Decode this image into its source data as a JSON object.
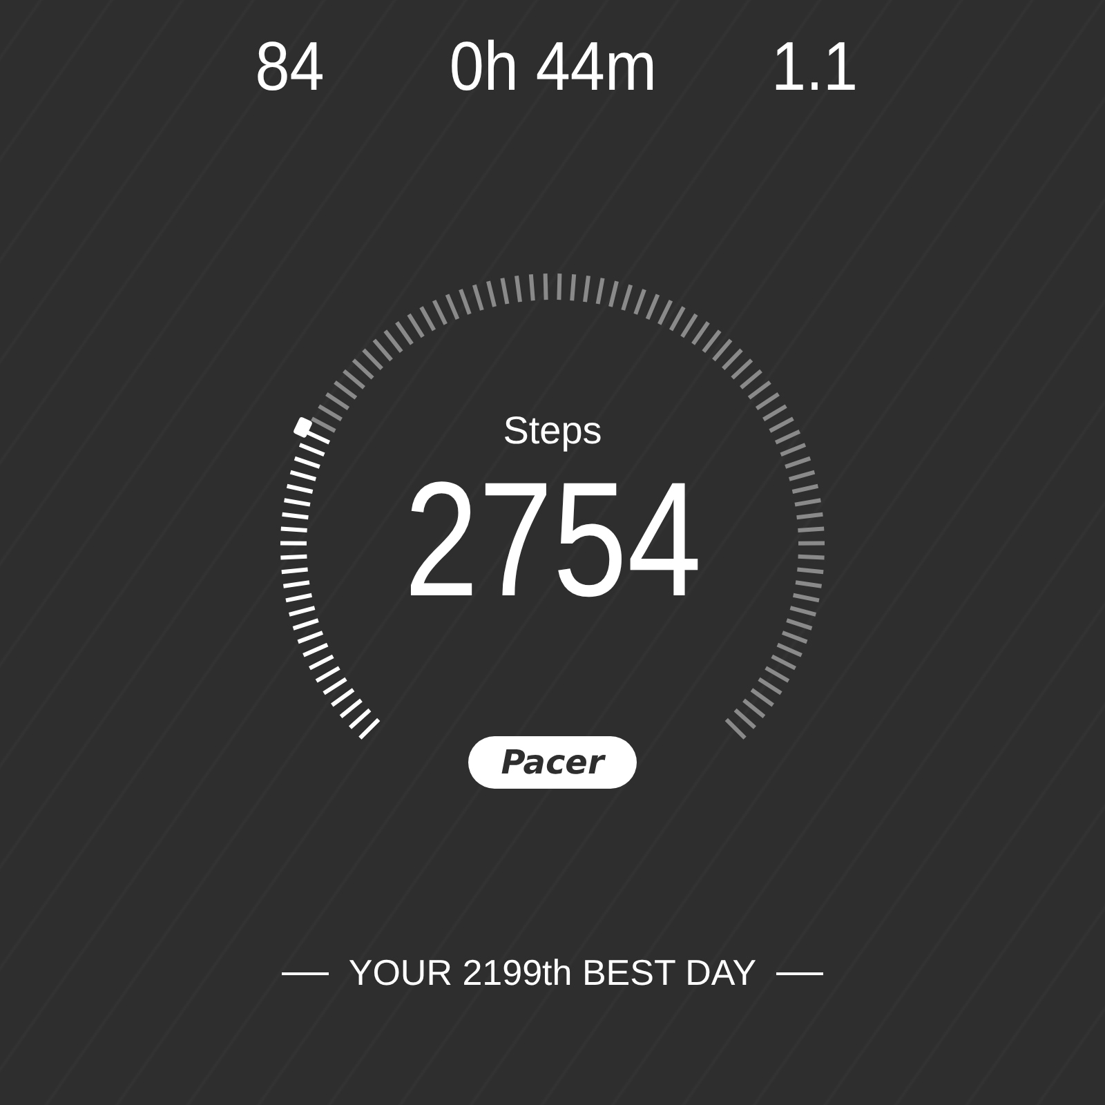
{
  "stats": [
    {
      "value": "84"
    },
    {
      "value": "0h 44m"
    },
    {
      "value": "1.1"
    }
  ],
  "gauge": {
    "label": "Steps",
    "value": "2754"
  },
  "logo": "Pacer",
  "best_day": "YOUR 2199th BEST DAY"
}
